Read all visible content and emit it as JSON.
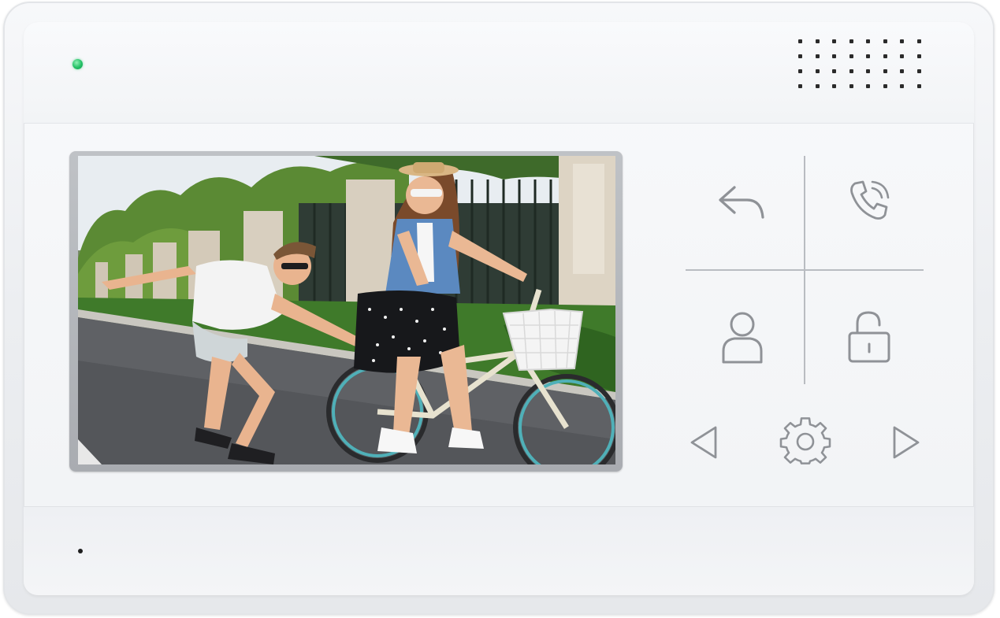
{
  "device": {
    "type": "video-intercom-monitor",
    "body_color": "#f1f3f5",
    "led_color": "#22c065",
    "icon_color": "#8f9297"
  },
  "screen": {
    "content": "camera-feed",
    "scene_colors": {
      "sky": "#e9eef2",
      "foliage": "#4f7d2e",
      "road": "#5d5f62",
      "fence": "#2d3a33",
      "pillar": "#ddd5c6"
    }
  },
  "controls": [
    {
      "id": "back",
      "label": "Back",
      "icon": "reply-arrow-icon"
    },
    {
      "id": "call",
      "label": "Call",
      "icon": "phone-ringing-icon"
    },
    {
      "id": "user",
      "label": "Contacts",
      "icon": "user-icon"
    },
    {
      "id": "unlock",
      "label": "Unlock",
      "icon": "padlock-open-icon"
    },
    {
      "id": "left",
      "label": "Previous",
      "icon": "triangle-left-icon"
    },
    {
      "id": "settings",
      "label": "Settings",
      "icon": "gear-icon"
    },
    {
      "id": "right",
      "label": "Next",
      "icon": "triangle-right-icon"
    }
  ]
}
